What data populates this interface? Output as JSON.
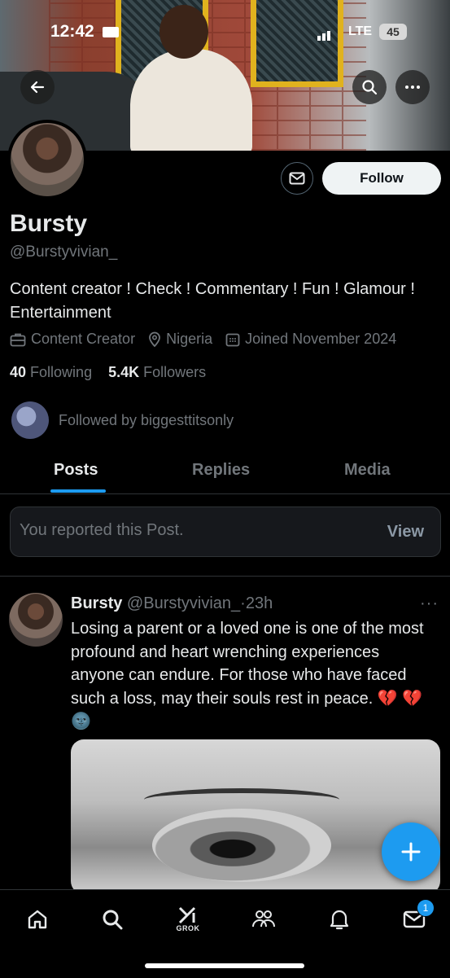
{
  "status_bar": {
    "time": "12:42",
    "network": "LTE",
    "battery": "45"
  },
  "profile": {
    "name": "Bursty",
    "handle": "@Burstyvivian_",
    "bio": "Content creator ! Check ! Commentary ! Fun ! Glamour ! Entertainment",
    "category": "Content Creator",
    "location": "Nigeria",
    "joined": "Joined November 2024",
    "following_count": "40",
    "following_label": "Following",
    "followers_count": "5.4K",
    "followers_label": "Followers",
    "followed_by": "Followed by biggesttitsonly",
    "follow_label": "Follow"
  },
  "tabs": [
    {
      "label": "Posts",
      "active": true
    },
    {
      "label": "Replies",
      "active": false
    },
    {
      "label": "Media",
      "active": false
    }
  ],
  "report_notice": {
    "text": "You reported this Post.",
    "action": "View"
  },
  "post": {
    "author": "Bursty",
    "handle": "@Burstyvivian_",
    "separator": "·",
    "time": "23h",
    "text": "Losing a parent or a loved one is one of the most profound and heart wrenching experiences anyone can endure. For those who have faced such a loss, may their souls rest in peace.",
    "emojis": "💔 💔 🌚",
    "more": "···"
  },
  "bottom_nav": {
    "items": [
      "home-icon",
      "search-icon",
      "grok-icon",
      "communities-icon",
      "notifications-icon",
      "messages-icon"
    ],
    "grok_label": "GROK",
    "messages_badge": "1"
  },
  "colors": {
    "accent": "#1d9bf0",
    "background": "#000000",
    "muted": "#71767b"
  }
}
